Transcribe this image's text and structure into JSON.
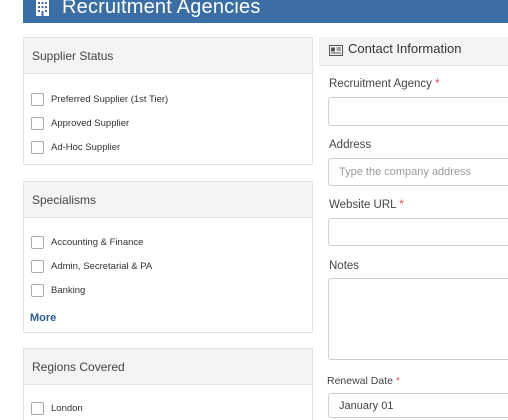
{
  "header": {
    "title": "Recruitment Agencies",
    "icon": "building-icon",
    "color": "#3b6ea3"
  },
  "supplier_status": {
    "title": "Supplier Status",
    "options": [
      "Preferred Supplier (1st Tier)",
      "Approved Supplier",
      "Ad-Hoc Supplier"
    ]
  },
  "specialisms": {
    "title": "Specialisms",
    "options": [
      "Accounting & Finance",
      "Admin, Secretarial & PA",
      "Banking"
    ],
    "more_label": "More"
  },
  "regions": {
    "title": "Regions Covered",
    "options": [
      "London"
    ]
  },
  "contact": {
    "title": "Contact Information",
    "icon": "id-card-icon",
    "fields": {
      "agency": {
        "label": "Recruitment Agency",
        "required": "*",
        "value": ""
      },
      "address": {
        "label": "Address",
        "placeholder": "Type the company address",
        "value": ""
      },
      "website": {
        "label": "Website URL",
        "required": "*",
        "value": ""
      },
      "notes": {
        "label": "Notes",
        "value": ""
      },
      "renewal": {
        "label": "Renewal Date",
        "required": "*",
        "value": "January 01"
      }
    }
  }
}
